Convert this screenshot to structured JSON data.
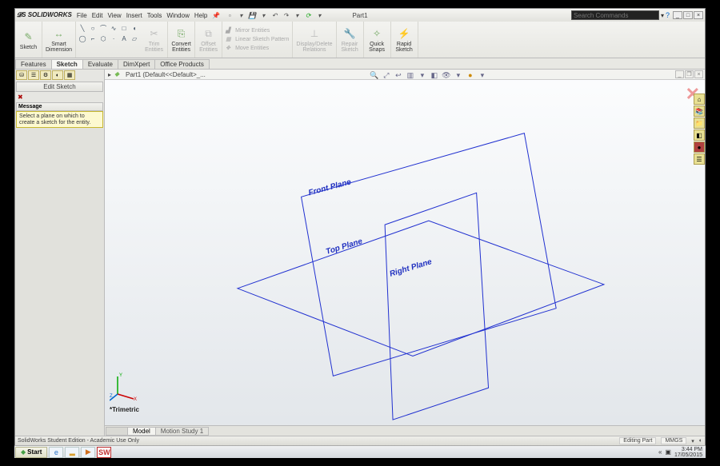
{
  "title": {
    "app": "SOLIDWORKS",
    "doc": "Part1"
  },
  "menu": [
    "File",
    "Edit",
    "View",
    "Insert",
    "Tools",
    "Window",
    "Help"
  ],
  "search": {
    "placeholder": "Search Commands"
  },
  "ribbon": {
    "sketch": "Sketch",
    "smart_dim": "Smart\nDimension",
    "trim": "Trim\nEntities",
    "convert": "Convert\nEntities",
    "offset": "Offset\nEntities",
    "mirror": "Mirror Entities",
    "linear": "Linear Sketch Pattern",
    "move": "Move Entities",
    "disp": "Display/Delete\nRelations",
    "repair": "Repair\nSketch",
    "quick": "Quick\nSnaps",
    "rapid": "Rapid\nSketch"
  },
  "tabs": [
    "Features",
    "Sketch",
    "Evaluate",
    "DimXpert",
    "Office Products"
  ],
  "tabs_active": 1,
  "panel": {
    "title": "Edit Sketch",
    "msg_hdr": "Message",
    "msg": "Select a plane on which to create a sketch for the entity."
  },
  "doc_header": "Part1 (Default<<Default>_...",
  "planes": {
    "front": "Front Plane",
    "top": "Top Plane",
    "right": "Right Plane"
  },
  "view_name": "*Trimetric",
  "bottom_tabs": [
    "Model",
    "Motion Study 1"
  ],
  "status": {
    "text": "SolidWorks Student Edition - Academic Use Only",
    "mode": "Editing Part",
    "units": "MMGS"
  },
  "taskbar": {
    "start": "Start",
    "time": "3:44 PM",
    "date": "17/05/2015"
  }
}
